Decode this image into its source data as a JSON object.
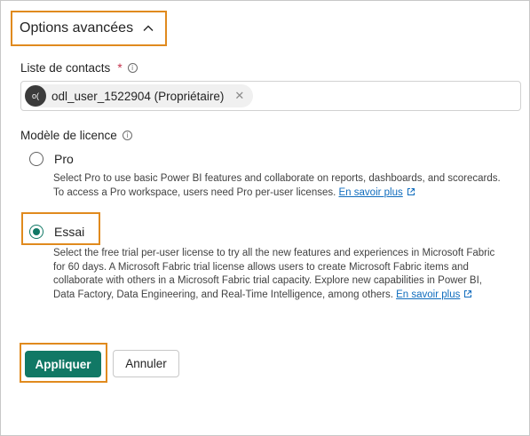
{
  "advanced": {
    "title": "Options avancées",
    "toggle_icon": "chevron-up-icon"
  },
  "contacts": {
    "label": "Liste de contacts",
    "required_mark": "*",
    "info_icon": "info-icon",
    "chip": {
      "avatar_initials": "o(",
      "text": "odl_user_1522904 (Propriétaire)",
      "remove_icon": "close-icon"
    }
  },
  "license": {
    "label": "Modèle de licence",
    "info_icon": "info-icon",
    "options": [
      {
        "label": "Pro",
        "checked": false,
        "description": "Select Pro to use basic Power BI features and collaborate on reports, dashboards, and scorecards. To access a Pro workspace, users need Pro per-user licenses.",
        "link": "En savoir plus"
      },
      {
        "label": "Essai",
        "checked": true,
        "description": "Select the free trial per-user license to try all the new features and experiences in Microsoft Fabric for 60 days. A Microsoft Fabric trial license allows users to create Microsoft Fabric items and collaborate with others in a Microsoft Fabric trial capacity. Explore new capabilities in Power BI, Data Factory, Data Engineering, and Real-Time Intelligence, among others.",
        "link": "En savoir plus"
      }
    ]
  },
  "actions": {
    "apply": "Appliquer",
    "cancel": "Annuler"
  },
  "colors": {
    "accent": "#117865",
    "highlight": "#e08a1e",
    "link": "#0f6cbd"
  }
}
